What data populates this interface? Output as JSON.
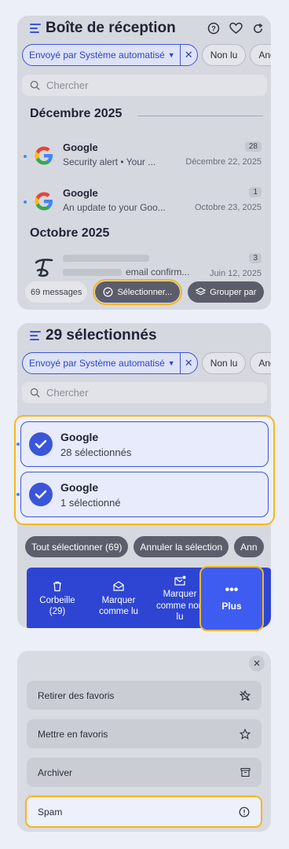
{
  "colors": {
    "accent": "#3a56d8",
    "highlight": "#f3b71f",
    "toolbar": "#2d45d2"
  },
  "inbox": {
    "title": "Boîte de réception",
    "filter_chip": "Envoyé par Système automatisé",
    "chip_unread": "Non lu",
    "chip_cut": "Anc",
    "search_placeholder": "Chercher",
    "sections": [
      {
        "title": "Décembre 2025"
      },
      {
        "title": "Octobre 2025"
      }
    ],
    "mails": [
      {
        "sender": "Google",
        "preview": "Security alert • Your ...",
        "count": "28",
        "date": "Décembre 22, 2025"
      },
      {
        "sender": "Google",
        "preview": "An update to your Goo...",
        "count": "1",
        "date": "Octobre 23, 2025"
      },
      {
        "preview": "email confirm...",
        "count": "3",
        "date": "Juin 12, 2025"
      }
    ],
    "messages_count": "69 messages",
    "select_button": "Sélectionner...",
    "group_button": "Grouper par"
  },
  "selection": {
    "title": "29 sélectionnés",
    "filter_chip": "Envoyé par Système automatisé",
    "chip_unread": "Non lu",
    "chip_cut": "Anc",
    "search_placeholder": "Chercher",
    "cards": [
      {
        "sender": "Google",
        "count": "28 sélectionnés"
      },
      {
        "sender": "Google",
        "count": "1 sélectionné"
      }
    ],
    "select_all": "Tout sélectionner (69)",
    "cancel_selection": "Annuler la sélection",
    "cut_action": "Ann",
    "toolbar": {
      "trash_l1": "Corbeille",
      "trash_l2": "(29)",
      "read_l1": "Marquer",
      "read_l2": "comme lu",
      "unread_l1": "Marquer",
      "unread_l2": "comme non",
      "unread_l3": "lu",
      "more": "Plus"
    }
  },
  "menu": {
    "options": [
      {
        "label": "Retirer des favoris",
        "icon": "star-off-icon"
      },
      {
        "label": "Mettre en favoris",
        "icon": "star-icon"
      },
      {
        "label": "Archiver",
        "icon": "archive-icon"
      },
      {
        "label": "Spam",
        "icon": "alert-circle-icon"
      }
    ]
  }
}
